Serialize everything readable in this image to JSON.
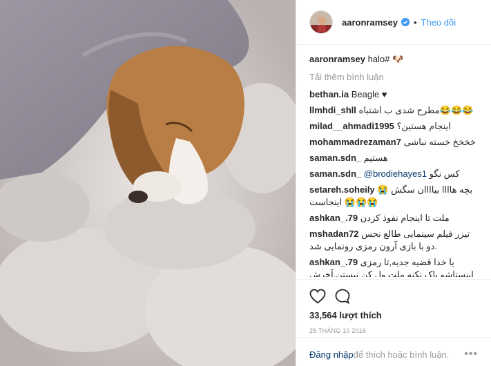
{
  "header": {
    "username": "aaronramsey",
    "separator": "•",
    "follow_label": "Theo dõi"
  },
  "caption": {
    "username": "aaronramsey",
    "text": "‫🐶 #halo‬"
  },
  "load_more": "Tải thêm bình luận",
  "comments": [
    {
      "user": "bethan.ia",
      "text": "Beagle ♥",
      "rtl": false
    },
    {
      "user": "llmhdi_shll",
      "text": "مطرح شدی ب اشتباه😂😂😂",
      "rtl": false
    },
    {
      "user": "milad__ahmadi1995",
      "text": "اینجام هستین؟",
      "rtl": false
    },
    {
      "user": "mohammadrezaman7",
      "text": "خخخخ خسته نباشی",
      "rtl": false
    },
    {
      "user": "saman.sdn_",
      "text": "هستیم",
      "rtl": false
    },
    {
      "user": "saman.sdn_",
      "mention": "@brodiehayes1",
      "text": "کس نگو",
      "rtl": false
    },
    {
      "user": "setareh.soheily",
      "text": "😭 بچه هاااا بیاااان سگش اینجاست 😭😭😭",
      "rtl": false
    },
    {
      "user": "ashkan_.79",
      "text": "ملت تا اینجام نفوذ کردن",
      "rtl": false
    },
    {
      "user": "mshadan72",
      "text": "تیزر فیلم سینمایی طالع نحس دو با بازی آرون رمزی رونمایی شد.",
      "rtl": false
    },
    {
      "user": "ashkan_.79",
      "text": "یا خدا قضیه جدیه,تا رمزی اینستاشو پاک نکنه ملت ول کن نیستن,آخرش گریه خفه کردن ایرانیا رو اینستا میزاره میگه نه نگا کن,این گربه برداشتن کامنت هم بذاری!! لول ما اما علا اختی بود ما نگاه",
      "rtl": false
    }
  ],
  "actions": {
    "likes": "33,564 lượt thích",
    "date": "25 THÁNG 10 2016"
  },
  "add_comment": {
    "login": "Đăng nhập",
    "text": " để thích hoặc bình luận.",
    "more": "•••"
  },
  "colors": {
    "link": "#3897f0",
    "mention": "#003569",
    "muted": "#999999"
  },
  "icons": [
    "heart-icon",
    "comment-icon",
    "verified-badge-icon",
    "more-options-icon"
  ]
}
